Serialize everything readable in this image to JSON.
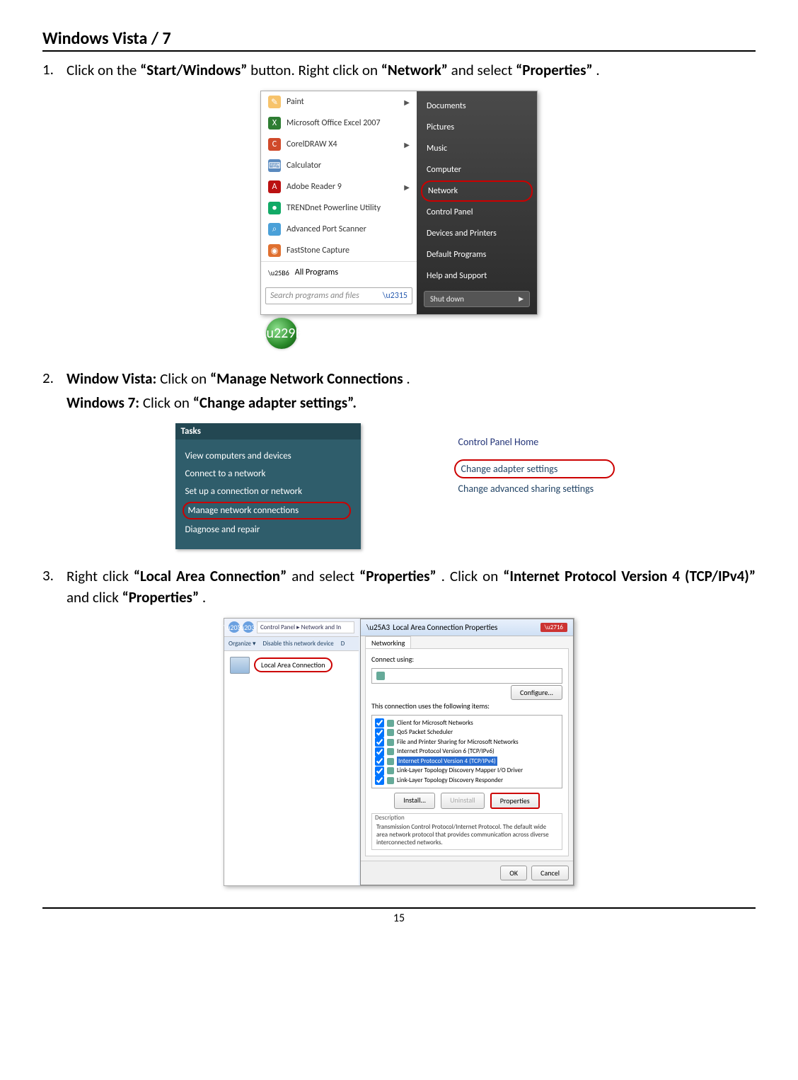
{
  "title": "Windows Vista / 7",
  "step1": {
    "num": "1.",
    "p1": "Click on the ",
    "b1": "“Start/Windows”",
    "p2": " button. Right click on ",
    "b2": "“Network”",
    "p3": " and select ",
    "b3": "“Properties”",
    "p4": "."
  },
  "startmenu": {
    "left_items": [
      {
        "icon_bg": "#f7c36b",
        "icon_txt": "✎",
        "label": "Paint",
        "arrow": true
      },
      {
        "icon_bg": "#2e7d32",
        "icon_txt": "X",
        "label": "Microsoft Office Excel 2007",
        "arrow": false
      },
      {
        "icon_bg": "#d04a2a",
        "icon_txt": "C",
        "label": "CorelDRAW X4",
        "arrow": true
      },
      {
        "icon_bg": "#5a8abf",
        "icon_txt": "⌨",
        "label": "Calculator",
        "arrow": false
      },
      {
        "icon_bg": "#b11",
        "icon_txt": "A",
        "label": "Adobe Reader 9",
        "arrow": true
      },
      {
        "icon_bg": "#1a6",
        "icon_txt": "●",
        "label": "TRENDnet Powerline Utility",
        "arrow": false
      },
      {
        "icon_bg": "#4aa0d8",
        "icon_txt": "⌕",
        "label": "Advanced Port Scanner",
        "arrow": false
      },
      {
        "icon_bg": "#e07030",
        "icon_txt": "◉",
        "label": "FastStone Capture",
        "arrow": false
      }
    ],
    "all_programs": "All Programs",
    "search_placeholder": "Search programs and files",
    "right_items": [
      "Documents",
      "Pictures",
      "Music",
      "Computer",
      "Network",
      "Control Panel",
      "Devices and Printers",
      "Default Programs",
      "Help and Support"
    ],
    "highlight_index": 4,
    "shutdown": "Shut down"
  },
  "step2": {
    "num": "2.",
    "b1": "Window Vista:",
    "p1": " Click on ",
    "b2": "“Manage Network Connections",
    "p2": ".",
    "b3": "Windows 7:",
    "p3": " Click on ",
    "b4": "“Change adapter settings”."
  },
  "tasks": {
    "header": "Tasks",
    "items": [
      "View computers and devices",
      "Connect to a network",
      "Set up a connection or network",
      "Manage network connections",
      "Diagnose and repair"
    ],
    "highlight_index": 3
  },
  "cp7": {
    "header": "Control Panel Home",
    "items": [
      "Change adapter settings",
      "Change advanced sharing settings"
    ],
    "highlight_index": 0
  },
  "step3": {
    "num": "3.",
    "p1": "Right click ",
    "b1": "“Local Area Connection”",
    "p2": " and select ",
    "b2": "“Properties”",
    "p3": ". Click on ",
    "b3": "“Internet Protocol Version 4 (TCP/IPv4)”",
    "p4": " and click ",
    "b4": "“Properties”",
    "p5": "."
  },
  "explorer": {
    "breadcrumb": "Control Panel  ▸  Network and In",
    "organize": "Organize ▾",
    "disable": "Disable this network device",
    "d_label": "D",
    "conn_name": "Local Area Connection"
  },
  "dialog": {
    "title": "Local Area Connection Properties",
    "tab": "Networking",
    "connect_using": "Connect using:",
    "adapter": "",
    "configure": "Configure...",
    "list_label": "This connection uses the following items:",
    "items": [
      "Client for Microsoft Networks",
      "QoS Packet Scheduler",
      "File and Printer Sharing for Microsoft Networks",
      "Internet Protocol Version 6 (TCP/IPv6)",
      "Internet Protocol Version 4 (TCP/IPv4)",
      "Link-Layer Topology Discovery Mapper I/O Driver",
      "Link-Layer Topology Discovery Responder"
    ],
    "selected_index": 4,
    "install": "Install...",
    "uninstall": "Uninstall",
    "properties": "Properties",
    "desc_label": "Description",
    "desc_text": "Transmission Control Protocol/Internet Protocol. The default wide area network protocol that provides communication across diverse interconnected networks.",
    "ok": "OK",
    "cancel": "Cancel"
  },
  "page_number": "15"
}
